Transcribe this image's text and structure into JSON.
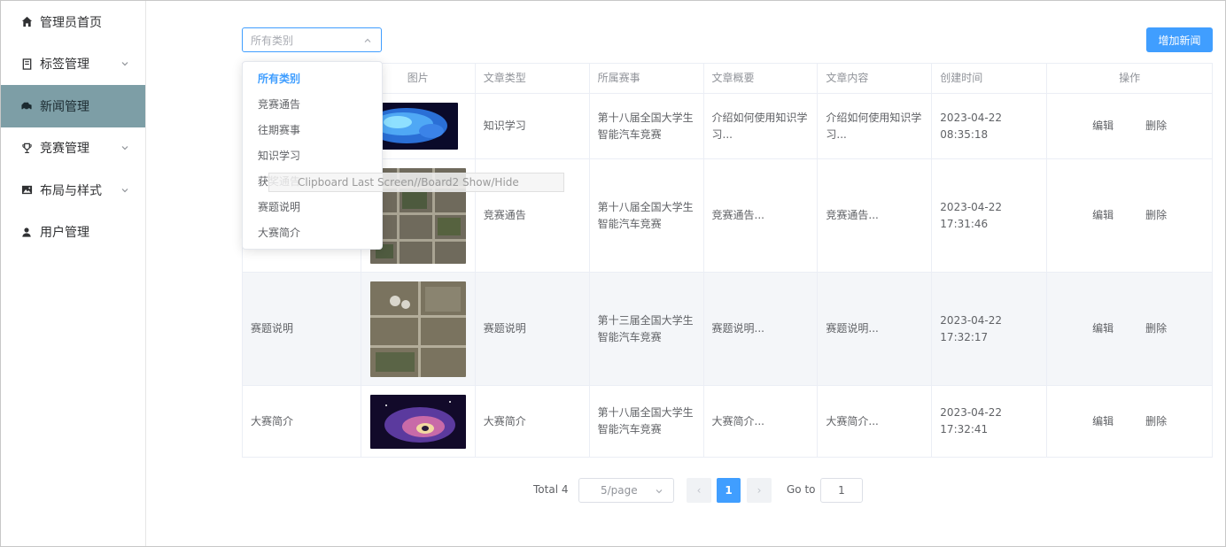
{
  "sidebar": {
    "items": [
      {
        "label": "管理员首页",
        "icon": "home-icon",
        "has_arrow": false
      },
      {
        "label": "标签管理",
        "icon": "bookmark-icon",
        "has_arrow": true
      },
      {
        "label": "新闻管理",
        "icon": "news-icon",
        "has_arrow": false
      },
      {
        "label": "竞赛管理",
        "icon": "trophy-icon",
        "has_arrow": true
      },
      {
        "label": "布局与样式",
        "icon": "picture-icon",
        "has_arrow": true
      },
      {
        "label": "用户管理",
        "icon": "user-icon",
        "has_arrow": false
      }
    ],
    "active_index": 2
  },
  "filter": {
    "placeholder": "所有类别",
    "options": [
      "所有类别",
      "竞赛通告",
      "往期赛事",
      "知识学习",
      "获奖通告",
      "赛题说明",
      "大赛简介"
    ],
    "selected_index": 0
  },
  "add_button": "增加新闻",
  "tooltip": "Clipboard Last Screen//Board2 Show/Hide",
  "table": {
    "headers": [
      "",
      "图片",
      "文章类型",
      "所属赛事",
      "文章概要",
      "文章内容",
      "创建时间",
      "操作"
    ],
    "rows": [
      {
        "title": "",
        "image": "blue-shape",
        "type": "知识学习",
        "event": "第十八届全国大学生智能汽车竞赛",
        "summary": "介绍如何使用知识学习...",
        "content": "介绍如何使用知识学习...",
        "created": "2023-04-22 08:35:18",
        "edit": "编辑",
        "delete": "删除"
      },
      {
        "title": "",
        "image": "aerial-town-1",
        "type": "竞赛通告",
        "event": "第十八届全国大学生智能汽车竞赛",
        "summary": "竞赛通告...",
        "content": "竞赛通告...",
        "created": "2023-04-22 17:31:46",
        "edit": "编辑",
        "delete": "删除"
      },
      {
        "title": "赛题说明",
        "image": "aerial-town-2",
        "type": "赛题说明",
        "event": "第十三届全国大学生智能汽车竞赛",
        "summary": "赛题说明...",
        "content": "赛题说明...",
        "created": "2023-04-22 17:32:17",
        "edit": "编辑",
        "delete": "删除"
      },
      {
        "title": "大赛简介",
        "image": "space-nebula",
        "type": "大赛简介",
        "event": "第十八届全国大学生智能汽车竞赛",
        "summary": "大赛简介...",
        "content": "大赛简介...",
        "created": "2023-04-22 17:32:41",
        "edit": "编辑",
        "delete": "删除"
      }
    ]
  },
  "pagination": {
    "total_label": "Total 4",
    "page_size": "5/page",
    "current_page": "1",
    "prev_glyph": "‹",
    "next_glyph": "›",
    "goto_label": "Go to",
    "goto_value": "1"
  },
  "colors": {
    "accent": "#409eff",
    "active_menu": "#7d9ea6"
  }
}
